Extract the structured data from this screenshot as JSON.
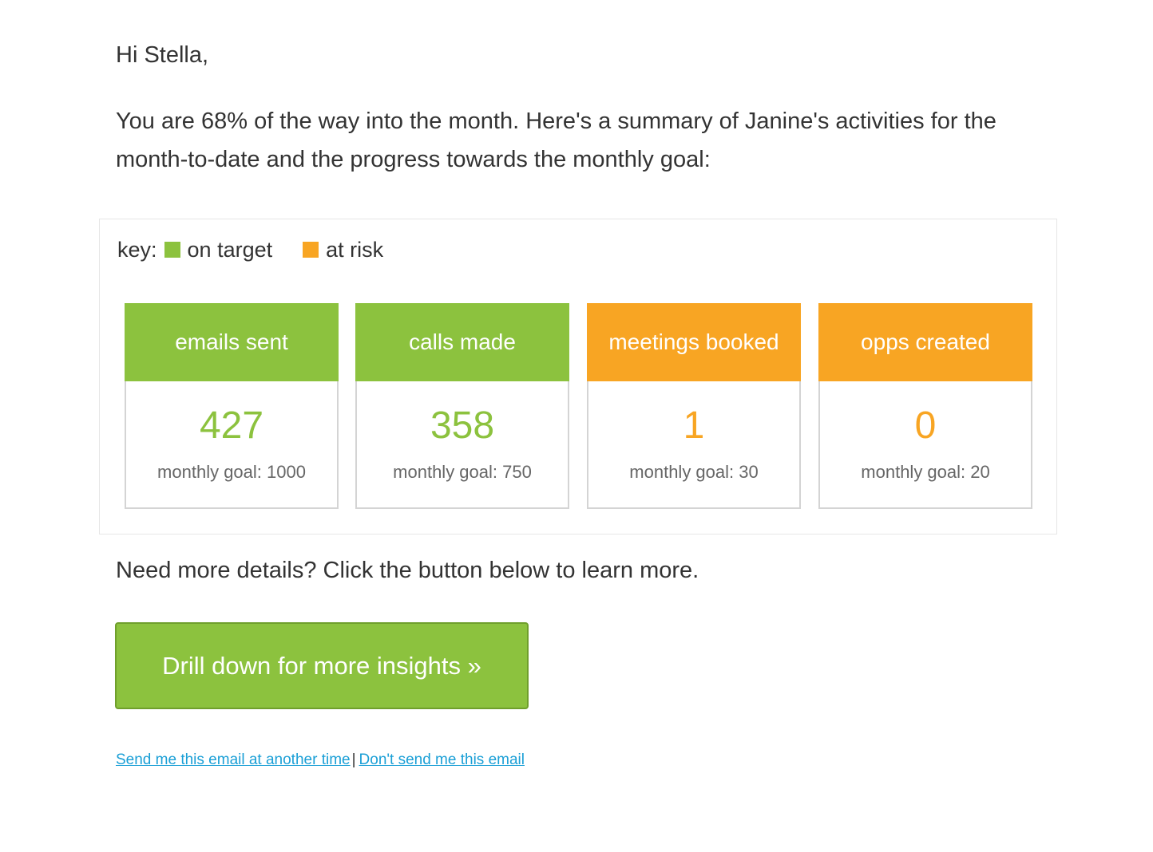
{
  "greeting": "Hi Stella,",
  "intro": "You are 68% of the way into the month. Here's a summary of Janine's activities for the month-to-date and the progress towards the monthly goal:",
  "key": {
    "label": "key:",
    "on_target": "on target",
    "at_risk": "at risk"
  },
  "colors": {
    "on_target": "#8cc23e",
    "at_risk": "#f8a523",
    "link": "#1a9fd6"
  },
  "cards": [
    {
      "title": "emails sent",
      "value": "427",
      "goal": "monthly goal: 1000",
      "status": "on_target"
    },
    {
      "title": "calls made",
      "value": "358",
      "goal": "monthly goal: 750",
      "status": "on_target"
    },
    {
      "title": "meetings booked",
      "value": "1",
      "goal": "monthly goal: 30",
      "status": "at_risk"
    },
    {
      "title": "opps created",
      "value": "0",
      "goal": "monthly goal: 20",
      "status": "at_risk"
    }
  ],
  "details": "Need more details? Click the button below to learn more.",
  "cta_label": "Drill down for more insights »",
  "footer": {
    "link_reschedule": "Send me this email at another time",
    "separator": "|",
    "link_unsubscribe": "Don't send me this email"
  }
}
